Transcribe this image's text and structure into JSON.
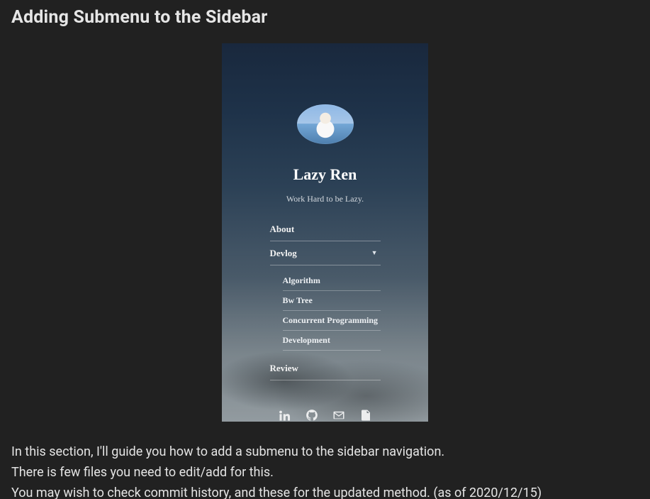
{
  "heading": "Adding Submenu to the Sidebar",
  "demo": {
    "site_title": "Lazy Ren",
    "tagline": "Work Hard to be Lazy.",
    "nav": {
      "about": "About",
      "devlog": "Devlog",
      "submenu": {
        "algorithm": "Algorithm",
        "bwtree": "Bw Tree",
        "concurrent": "Concurrent Programming",
        "development": "Development"
      },
      "review": "Review"
    }
  },
  "body": {
    "line1": "In this section, I'll guide you how to add a submenu to the sidebar navigation.",
    "line2": "There is few files you need to edit/add for this.",
    "line3_pre": "You may wish to check ",
    "link_commit": "commit history",
    "sep": ", ",
    "link_and": "and",
    "space": " ",
    "link_these": "these",
    "line3_post": " for the updated method. (as of 2020/12/15)"
  }
}
